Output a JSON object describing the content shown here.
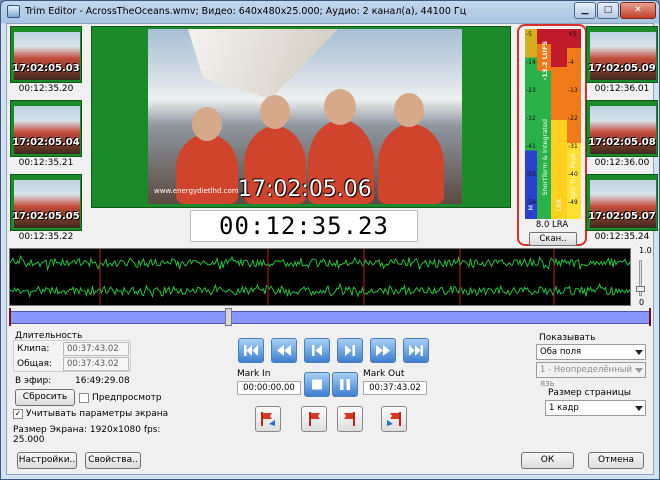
{
  "window": {
    "title": "Trim Editor - AcrossTheOceans.wmv; Видео: 640x480x25.000; Аудио: 2 канал(а), 44100 Гц",
    "min_glyph": "▁",
    "max_glyph": "□",
    "close_glyph": "✕"
  },
  "thumbs_left": [
    {
      "tc": "17:02:05.03",
      "caption": "00:12:35.20"
    },
    {
      "tc": "17:02:05.04",
      "caption": "00:12:35.21"
    },
    {
      "tc": "17:02:05.05",
      "caption": "00:12:35.22"
    }
  ],
  "thumbs_right": [
    {
      "tc": "17:02:05.09",
      "caption": "00:12:36.01"
    },
    {
      "tc": "17:02:05.08",
      "caption": "00:12:36.00"
    },
    {
      "tc": "17:02:05.07",
      "caption": "00:12:35.24"
    }
  ],
  "video": {
    "overlay_tc": "17:02:05.06",
    "site": "www.energydietlhd.com",
    "time": "00:12:35.23"
  },
  "meter": {
    "ticks": [
      "-5",
      "-14",
      "-23",
      "-32",
      "-41",
      "-50",
      "-59"
    ],
    "right_ticks": [
      "+5",
      "-4",
      "-13",
      "-22",
      "-31",
      "-40",
      "-49"
    ],
    "lufs": "-13.2 LUFS",
    "label_mid": "ShortTerm & Integrated",
    "label_left": "M",
    "label_lra": "LRA",
    "label_peak": "Right True Peak",
    "lra": "8.0 LRA",
    "scan": "Скан.."
  },
  "volume": {
    "max": "1.0",
    "min": "0",
    "level": 0.15
  },
  "timeline": {
    "position": 0.34
  },
  "duration": {
    "heading": "Длительность",
    "clip_label": "Клипа:",
    "clip_value": "00:37:43.02",
    "total_label": "Общая:",
    "total_value": "00:37:43.02"
  },
  "onair": {
    "label": "В эфир:",
    "value": "16:49:29.08"
  },
  "reset_btn": "Сбросить",
  "preview_label": "Предпросмотр",
  "screen_params_label": "Учитывать параметры экрана",
  "screen_size": {
    "label": "Размер Экрана: 1920x1080 fps:",
    "fps": "25.000"
  },
  "mark_in": {
    "label": "Mark In",
    "value": "00:00:00.00"
  },
  "mark_out": {
    "label": "Mark Out",
    "value": "00:37:43.02"
  },
  "show": {
    "label": "Показывать",
    "fields": "Оба поля",
    "lang": "1 - Неопределённый язь"
  },
  "page_size": {
    "label": "Размер страницы",
    "value": "1 кадр"
  },
  "buttons": {
    "settings": "Настройки..",
    "properties": "Свойства..",
    "ok": "ОК",
    "cancel": "Отмена"
  }
}
